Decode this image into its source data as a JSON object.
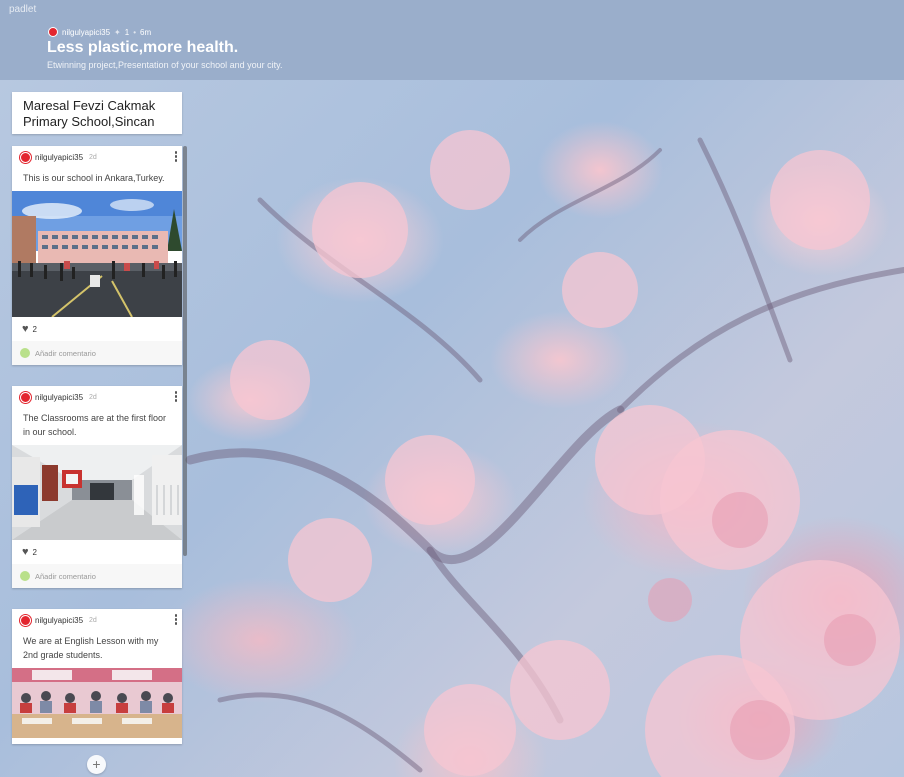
{
  "app": {
    "brand": "padlet"
  },
  "header": {
    "author": "nilgulyapici35",
    "likes": "1",
    "age": "6m",
    "title": "Less plastic,more health.",
    "subtitle": "Etwinning project,Presentation of your school and your city."
  },
  "section": {
    "title": "Maresal Fevzi Cakmak Primary School,Sincan"
  },
  "posts": [
    {
      "author": "nilgulyapici35",
      "time": "2d",
      "text": "This is our school in Ankara,Turkey.",
      "likes": "2",
      "comment_placeholder": "Añadir comentario"
    },
    {
      "author": "nilgulyapici35",
      "time": "2d",
      "text": "The Classrooms are at the first floor in our school.",
      "likes": "2",
      "comment_placeholder": "Añadir comentario"
    },
    {
      "author": "nilgulyapici35",
      "time": "2d",
      "text": "We are at English Lesson with my 2nd grade students."
    }
  ],
  "add_button": "+",
  "colors": {
    "header_bg": "#9aaecb",
    "avatar": "#e3262f",
    "comment_dot": "#b9e08a"
  }
}
